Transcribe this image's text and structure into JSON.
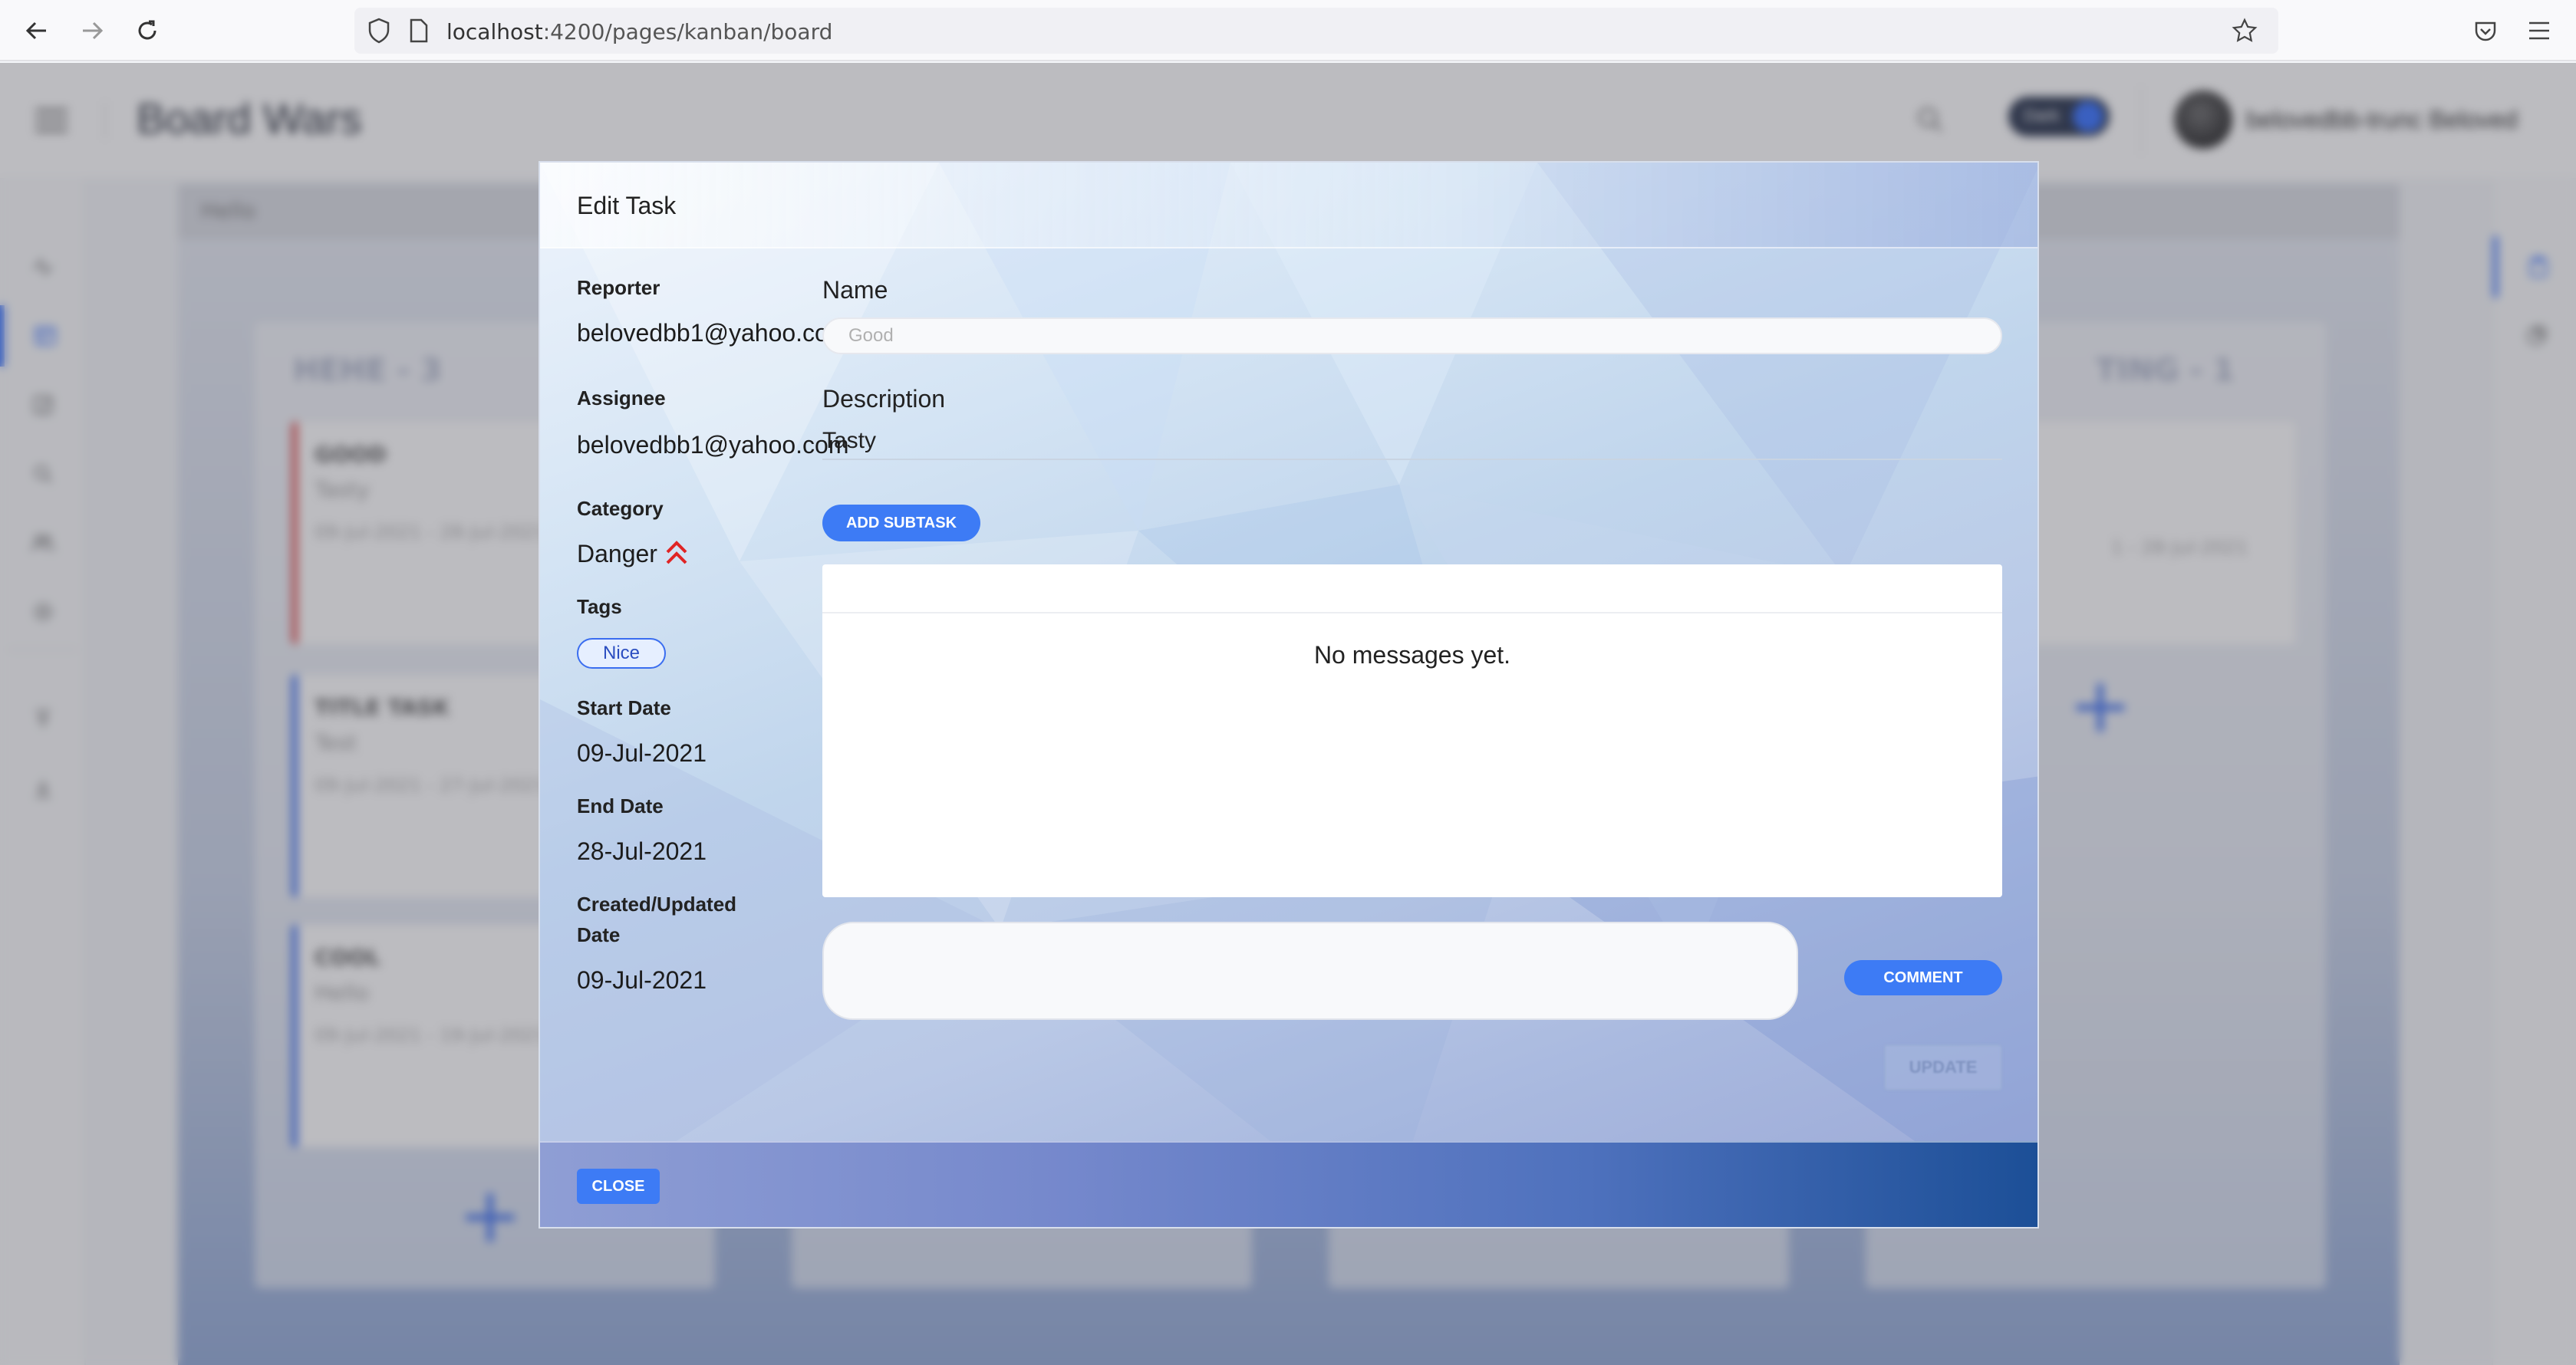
{
  "browser": {
    "url_host": "localhost",
    "url_path": ":4200/pages/kanban/board"
  },
  "header": {
    "title": "Board Wars",
    "dark_label": "Dark",
    "user_name": "belovedbb-trunc Beloved"
  },
  "board": {
    "hello": "Hello",
    "columns": [
      {
        "title": "HEHE - 3"
      },
      {
        "title": "TING - 1"
      }
    ],
    "cards": [
      {
        "title": "GOOD",
        "subtitle": "Tasty",
        "dates": "09-Jul-2021 - 28-Jul-2021"
      },
      {
        "title": "TITLE TASK",
        "subtitle": "Test",
        "dates": "09-Jul-2021 - 27-Jul-2021"
      },
      {
        "title": "COOL",
        "subtitle": "Hello",
        "dates": "09-Jul-2021 - 19-Jul-2021"
      },
      {
        "title": "",
        "subtitle": "",
        "dates": "1 - 28-Jul-2021"
      }
    ]
  },
  "modal": {
    "title": "Edit Task",
    "reporter_label": "Reporter",
    "reporter_value": "belovedbb1@yahoo.co",
    "assignee_label": "Assignee",
    "assignee_value": "belovedbb1@yahoo.com",
    "category_label": "Category",
    "category_value": "Danger",
    "tags_label": "Tags",
    "tags": [
      "Nice"
    ],
    "start_label": "Start Date",
    "start_value": "09-Jul-2021",
    "end_label": "End Date",
    "end_value": "28-Jul-2021",
    "created_label_1": "Created/Updated",
    "created_label_2": "Date",
    "created_value": "09-Jul-2021",
    "name_label": "Name",
    "name_placeholder": "Good",
    "description_label": "Description",
    "description_value": "Tasty",
    "add_subtask_label": "ADD SUBTASK",
    "no_messages": "No messages yet.",
    "comment_label": "COMMENT",
    "update_label": "UPDATE",
    "close_label": "CLOSE"
  },
  "colors": {
    "accent": "#3d7bf5",
    "danger": "#e02424"
  }
}
